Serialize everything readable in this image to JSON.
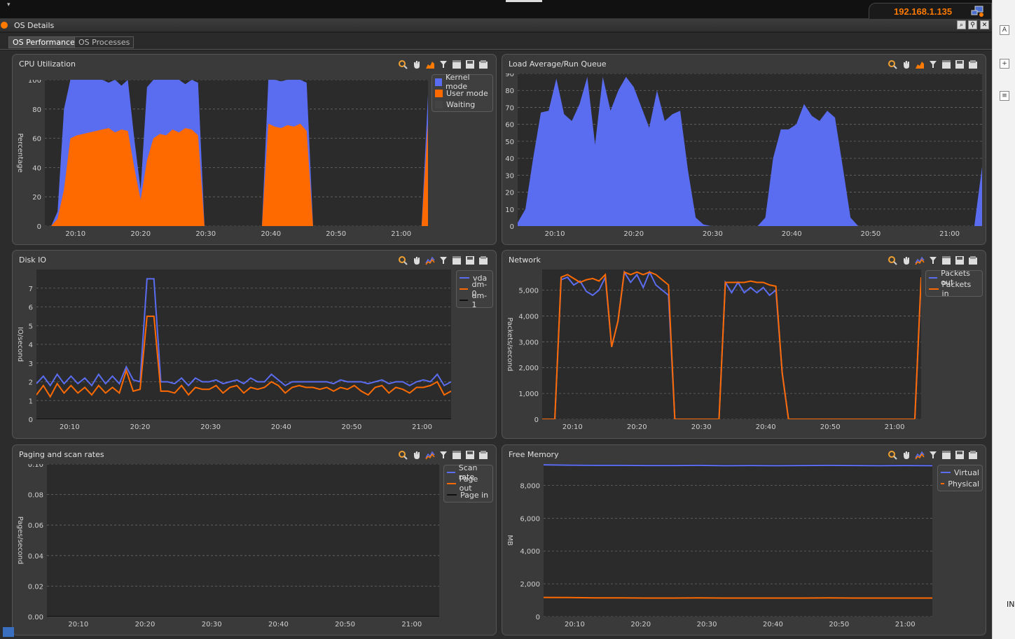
{
  "header": {
    "ip_address": "192.168.1.135"
  },
  "window": {
    "title": "OS Details"
  },
  "tabs": [
    {
      "label": "OS Performance",
      "active": true
    },
    {
      "label": "OS Processes",
      "active": false
    }
  ],
  "right_strip": {
    "label": "IN"
  },
  "colors": {
    "blue": "#5a6cf0",
    "orange": "#ff6a00",
    "gray": "#444444",
    "grid": "#6a6a6a"
  },
  "panels": {
    "cpu": {
      "title": "CPU Utilization",
      "legend": [
        "Kernel mode",
        "User mode",
        "Waiting"
      ]
    },
    "load": {
      "title": "Load Average/Run Queue"
    },
    "disk": {
      "title": "Disk IO",
      "legend": [
        "vda",
        "dm-0",
        "dm-1"
      ]
    },
    "network": {
      "title": "Network",
      "legend": [
        "Packets out",
        "Packets in"
      ]
    },
    "paging": {
      "title": "Paging and scan rates",
      "legend": [
        "Scan rate",
        "Page out",
        "Page in"
      ]
    },
    "memory": {
      "title": "Free Memory",
      "legend": [
        "Virtual",
        "Physical"
      ]
    }
  },
  "chart_data": [
    {
      "id": "cpu",
      "type": "area",
      "stacked": true,
      "ylabel": "Percentage",
      "xlim": [
        20.1,
        21.08
      ],
      "ylim": [
        0,
        100
      ],
      "yticks": [
        "0",
        "20",
        "40",
        "60",
        "80",
        "100"
      ],
      "xticks": [
        "20:10",
        "20:20",
        "20:30",
        "20:40",
        "20:50",
        "21:00"
      ],
      "grid": true,
      "legend_position": "top-right",
      "x": [
        "20:05",
        "20:06",
        "20:07",
        "20:08",
        "20:09",
        "20:10",
        "20:11",
        "20:12",
        "20:13",
        "20:14",
        "20:15",
        "20:16",
        "20:17",
        "20:18",
        "20:19",
        "20:20",
        "20:21",
        "20:22",
        "20:23",
        "20:24",
        "20:25",
        "20:26",
        "20:27",
        "20:28",
        "20:29",
        "20:30",
        "20:31",
        "20:32",
        "20:33",
        "20:34",
        "20:35",
        "20:36",
        "20:37",
        "20:38",
        "20:39",
        "20:40",
        "20:41",
        "20:42",
        "20:43",
        "20:44",
        "20:45",
        "20:46",
        "20:47",
        "20:48",
        "20:49",
        "20:50",
        "20:51",
        "20:52",
        "20:53",
        "20:54",
        "20:55",
        "20:56",
        "20:57",
        "20:58",
        "20:59",
        "21:00",
        "21:01",
        "21:02",
        "21:03",
        "21:04",
        "21:05"
      ],
      "series": [
        {
          "name": "User mode",
          "values": [
            0,
            0,
            5,
            25,
            60,
            62,
            63,
            64,
            65,
            66,
            67,
            64,
            66,
            65,
            40,
            18,
            45,
            60,
            63,
            62,
            66,
            64,
            67,
            66,
            62,
            0,
            0,
            0,
            0,
            0,
            0,
            0,
            0,
            0,
            0,
            70,
            68,
            67,
            69,
            68,
            70,
            65,
            0,
            0,
            0,
            0,
            0,
            0,
            0,
            0,
            0,
            0,
            0,
            0,
            0,
            0,
            0,
            0,
            0,
            0,
            70
          ]
        },
        {
          "name": "Kernel mode",
          "values": [
            0,
            0,
            10,
            80,
            100,
            100,
            100,
            100,
            100,
            100,
            98,
            100,
            96,
            100,
            60,
            25,
            95,
            100,
            100,
            100,
            100,
            100,
            97,
            100,
            98,
            0,
            0,
            0,
            0,
            0,
            0,
            0,
            0,
            0,
            0,
            100,
            100,
            99,
            100,
            100,
            100,
            98,
            0,
            0,
            0,
            0,
            0,
            0,
            0,
            0,
            0,
            0,
            0,
            0,
            0,
            0,
            0,
            0,
            0,
            0,
            90
          ]
        }
      ]
    },
    {
      "id": "load",
      "type": "area",
      "ylabel": "",
      "xlim": [
        20.05,
        21.08
      ],
      "ylim": [
        0,
        90
      ],
      "yticks": [
        "0",
        "10",
        "20",
        "30",
        "40",
        "50",
        "60",
        "70",
        "80",
        "90"
      ],
      "xticks": [
        "20:10",
        "20:20",
        "20:30",
        "20:40",
        "20:50",
        "21:00"
      ],
      "grid": true,
      "x": [
        "20:05",
        "20:06",
        "20:07",
        "20:08",
        "20:09",
        "20:10",
        "20:11",
        "20:12",
        "20:13",
        "20:14",
        "20:15",
        "20:16",
        "20:17",
        "20:18",
        "20:19",
        "20:20",
        "20:21",
        "20:22",
        "20:23",
        "20:24",
        "20:25",
        "20:26",
        "20:27",
        "20:28",
        "20:29",
        "20:30",
        "20:31",
        "20:32",
        "20:33",
        "20:34",
        "20:35",
        "20:36",
        "20:37",
        "20:38",
        "20:39",
        "20:40",
        "20:41",
        "20:42",
        "20:43",
        "20:44",
        "20:45",
        "20:46",
        "20:47",
        "20:48",
        "20:49",
        "20:50",
        "20:51",
        "20:52",
        "20:53",
        "20:54",
        "20:55",
        "20:56",
        "20:57",
        "20:58",
        "20:59",
        "21:00",
        "21:01",
        "21:02",
        "21:03",
        "21:04",
        "21:05"
      ],
      "series": [
        {
          "name": "Load",
          "values": [
            2,
            10,
            40,
            67,
            68,
            87,
            66,
            62,
            72,
            88,
            48,
            88,
            68,
            80,
            88,
            82,
            70,
            58,
            80,
            62,
            66,
            68,
            33,
            5,
            1,
            0,
            0,
            0,
            0,
            0,
            0,
            0,
            5,
            40,
            57,
            57,
            60,
            72,
            65,
            62,
            68,
            64,
            35,
            5,
            0,
            0,
            0,
            0,
            0,
            0,
            0,
            0,
            0,
            0,
            0,
            0,
            0,
            0,
            0,
            0,
            35
          ]
        }
      ]
    },
    {
      "id": "disk",
      "type": "line",
      "ylabel": "IO/second",
      "xlim": [
        20.05,
        21.08
      ],
      "ylim": [
        0,
        8
      ],
      "yticks": [
        "0",
        "1",
        "2",
        "3",
        "4",
        "5",
        "6",
        "7"
      ],
      "xticks": [
        "20:10",
        "20:20",
        "20:30",
        "20:40",
        "20:50",
        "21:00"
      ],
      "grid": true,
      "legend_position": "top-right",
      "series": [
        {
          "name": "vda",
          "values": [
            1.9,
            2.3,
            1.8,
            2.4,
            1.9,
            2.3,
            1.9,
            2.2,
            1.8,
            2.4,
            1.9,
            2.3,
            1.9,
            2.8,
            2.1,
            2.0,
            7.5,
            7.5,
            2.0,
            2.0,
            1.9,
            2.2,
            1.8,
            2.2,
            2.0,
            2.0,
            2.1,
            1.9,
            2.0,
            2.1,
            1.9,
            2.2,
            2.0,
            2.0,
            2.4,
            2.1,
            1.8,
            2.0,
            2.0,
            2.0,
            2.0,
            2.0,
            2.0,
            1.9,
            2.1,
            2.0,
            2.0,
            2.0,
            1.9,
            2.0,
            2.1,
            1.9,
            2.0,
            2.0,
            1.8,
            2.0,
            2.1,
            2.0,
            2.4,
            1.8,
            2.0
          ]
        },
        {
          "name": "dm-0",
          "values": [
            1.3,
            1.8,
            1.2,
            1.9,
            1.4,
            1.8,
            1.4,
            1.7,
            1.3,
            1.8,
            1.4,
            1.7,
            1.4,
            2.6,
            1.5,
            1.6,
            5.5,
            5.5,
            1.5,
            1.5,
            1.4,
            1.8,
            1.3,
            1.7,
            1.6,
            1.6,
            1.8,
            1.4,
            1.7,
            1.8,
            1.4,
            1.7,
            1.6,
            1.7,
            2.0,
            1.8,
            1.4,
            1.7,
            1.8,
            1.7,
            1.7,
            1.6,
            1.7,
            1.5,
            1.7,
            1.6,
            1.8,
            1.5,
            1.3,
            1.7,
            1.8,
            1.4,
            1.7,
            1.6,
            1.4,
            1.7,
            1.7,
            1.8,
            2.0,
            1.3,
            1.5
          ]
        },
        {
          "name": "dm-1",
          "values": [
            0,
            0,
            0,
            0,
            0,
            0,
            0,
            0,
            0,
            0,
            0,
            0,
            0,
            0,
            0,
            0,
            0,
            0,
            0,
            0,
            0,
            0,
            0,
            0,
            0,
            0,
            0,
            0,
            0,
            0,
            0,
            0,
            0,
            0,
            0,
            0,
            0,
            0,
            0,
            0,
            0,
            0,
            0,
            0,
            0,
            0,
            0,
            0,
            0,
            0,
            0,
            0,
            0,
            0,
            0,
            0,
            0,
            0,
            0,
            0,
            0
          ]
        }
      ]
    },
    {
      "id": "network",
      "type": "line",
      "ylabel": "Packets/second",
      "xlim": [
        20.05,
        21.08
      ],
      "ylim": [
        0,
        5800
      ],
      "yticks": [
        "0",
        "1,000",
        "2,000",
        "3,000",
        "4,000",
        "5,000"
      ],
      "xticks": [
        "20:10",
        "20:20",
        "20:30",
        "20:40",
        "20:50",
        "21:00"
      ],
      "grid": true,
      "legend_position": "top-right",
      "series": [
        {
          "name": "Packets out",
          "values": [
            0,
            0,
            0,
            5400,
            5500,
            5200,
            5350,
            4950,
            4800,
            5000,
            5500,
            2800,
            3800,
            5700,
            5300,
            5600,
            5100,
            5700,
            5200,
            5000,
            4800,
            0,
            0,
            0,
            0,
            0,
            0,
            0,
            0,
            5300,
            4900,
            5300,
            4900,
            5100,
            4900,
            5100,
            4800,
            5000,
            1800,
            0,
            0,
            0,
            0,
            0,
            0,
            0,
            0,
            0,
            0,
            0,
            0,
            0,
            0,
            0,
            0,
            0,
            0,
            0,
            0,
            0,
            5400
          ]
        },
        {
          "name": "Packets in",
          "values": [
            0,
            0,
            0,
            5500,
            5600,
            5450,
            5300,
            5400,
            5450,
            5350,
            5600,
            2800,
            3800,
            5700,
            5600,
            5700,
            5600,
            5700,
            5600,
            5400,
            5200,
            0,
            0,
            0,
            0,
            0,
            0,
            0,
            0,
            5300,
            5300,
            5300,
            5300,
            5350,
            5300,
            5300,
            5200,
            5150,
            1800,
            0,
            0,
            0,
            0,
            0,
            0,
            0,
            0,
            0,
            0,
            0,
            0,
            0,
            0,
            0,
            0,
            0,
            0,
            0,
            0,
            0,
            5500
          ]
        }
      ]
    },
    {
      "id": "paging",
      "type": "line",
      "ylabel": "Pages/second",
      "xlim": [
        20.05,
        21.08
      ],
      "ylim": [
        0,
        0.1
      ],
      "yticks": [
        "0.00",
        "0.02",
        "0.04",
        "0.06",
        "0.08",
        "0.10"
      ],
      "xticks": [
        "20:10",
        "20:20",
        "20:30",
        "20:40",
        "20:50",
        "21:00"
      ],
      "grid": true,
      "legend_position": "top-right",
      "series": [
        {
          "name": "Scan rate",
          "values": [
            0,
            0
          ]
        },
        {
          "name": "Page out",
          "values": [
            0,
            0
          ]
        },
        {
          "name": "Page in",
          "values": [
            0,
            0
          ]
        }
      ]
    },
    {
      "id": "memory",
      "type": "line",
      "ylabel": "MB",
      "xlim": [
        20.05,
        21.08
      ],
      "ylim": [
        0,
        9300
      ],
      "yticks": [
        "0",
        "2,000",
        "4,000",
        "6,000",
        "8,000"
      ],
      "xticks": [
        "20:10",
        "20:20",
        "20:30",
        "20:40",
        "20:50",
        "21:00"
      ],
      "grid": true,
      "legend_position": "top-right",
      "series": [
        {
          "name": "Virtual",
          "values": [
            9250,
            9230,
            9220,
            9220,
            9210,
            9210,
            9220,
            9200,
            9210,
            9200,
            9210,
            9220,
            9210,
            9200,
            9210,
            9200
          ]
        },
        {
          "name": "Physical",
          "values": [
            1170,
            1160,
            1140,
            1140,
            1130,
            1130,
            1140,
            1130,
            1130,
            1130,
            1130,
            1140,
            1130,
            1130,
            1130,
            1130
          ]
        }
      ]
    }
  ]
}
